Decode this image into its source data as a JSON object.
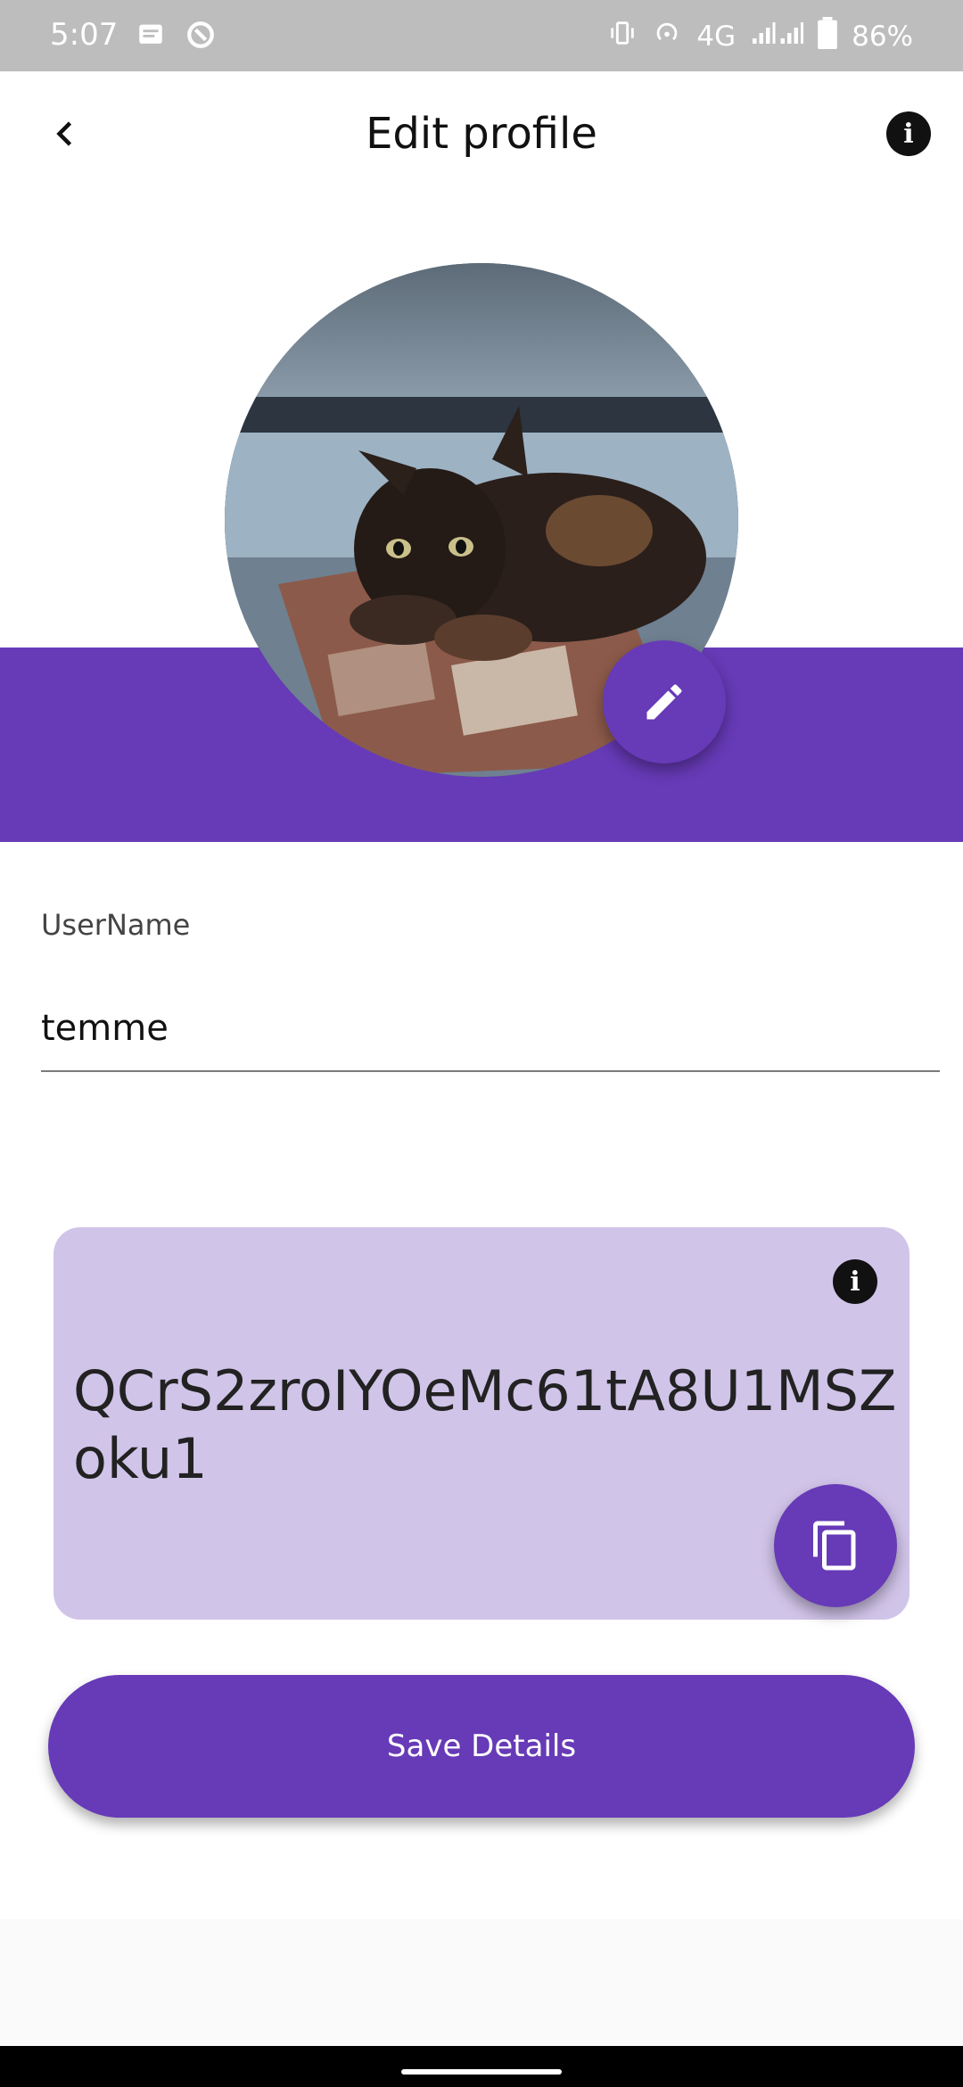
{
  "status_bar": {
    "time": "5:07",
    "network": "4G",
    "battery": "86%",
    "icons": [
      "message-icon",
      "sync-icon",
      "vibrate-icon",
      "hotspot-icon",
      "signal-icon",
      "battery-icon"
    ]
  },
  "header": {
    "title": "Edit profile",
    "back_icon": "chevron-left-icon",
    "info_icon": "info-icon"
  },
  "profile": {
    "avatar": "kitten-photo",
    "edit_icon": "pencil-icon",
    "accent_color": "#673ab7"
  },
  "form": {
    "username_label": "UserName",
    "username_value": "temme"
  },
  "id_card": {
    "user_id": "QCrS2zroIYOeMc61tA8U1MSZoku1",
    "info_icon": "info-icon",
    "copy_icon": "copy-icon",
    "background_color": "#d1c4e9"
  },
  "actions": {
    "save_label": "Save Details"
  }
}
